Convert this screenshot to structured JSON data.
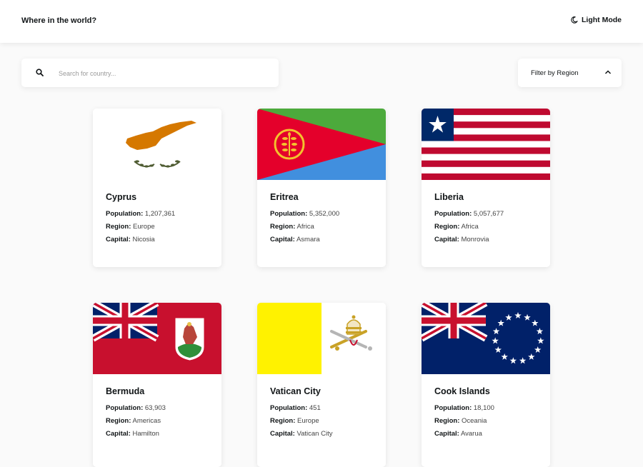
{
  "header": {
    "title": "Where in the world?",
    "mode_label": "Light Mode"
  },
  "search": {
    "placeholder": "Search for country..."
  },
  "filter": {
    "label": "Filter by Region"
  },
  "labels": {
    "population": "Population:",
    "region": "Region:",
    "capital": "Capital:"
  },
  "countries": [
    {
      "name": "Cyprus",
      "population": "1,207,361",
      "region": "Europe",
      "capital": "Nicosia"
    },
    {
      "name": "Eritrea",
      "population": "5,352,000",
      "region": "Africa",
      "capital": "Asmara"
    },
    {
      "name": "Liberia",
      "population": "5,057,677",
      "region": "Africa",
      "capital": "Monrovia"
    },
    {
      "name": "Bermuda",
      "population": "63,903",
      "region": "Americas",
      "capital": "Hamilton"
    },
    {
      "name": "Vatican City",
      "population": "451",
      "region": "Europe",
      "capital": "Vatican City"
    },
    {
      "name": "Cook Islands",
      "population": "18,100",
      "region": "Oceania",
      "capital": "Avarua"
    }
  ],
  "icons": {
    "mode": "moon-icon",
    "search": "search-icon",
    "filter": "chevron-up-icon"
  },
  "colors": {
    "background": "#fafafa",
    "card": "#ffffff",
    "text": "#111517"
  }
}
